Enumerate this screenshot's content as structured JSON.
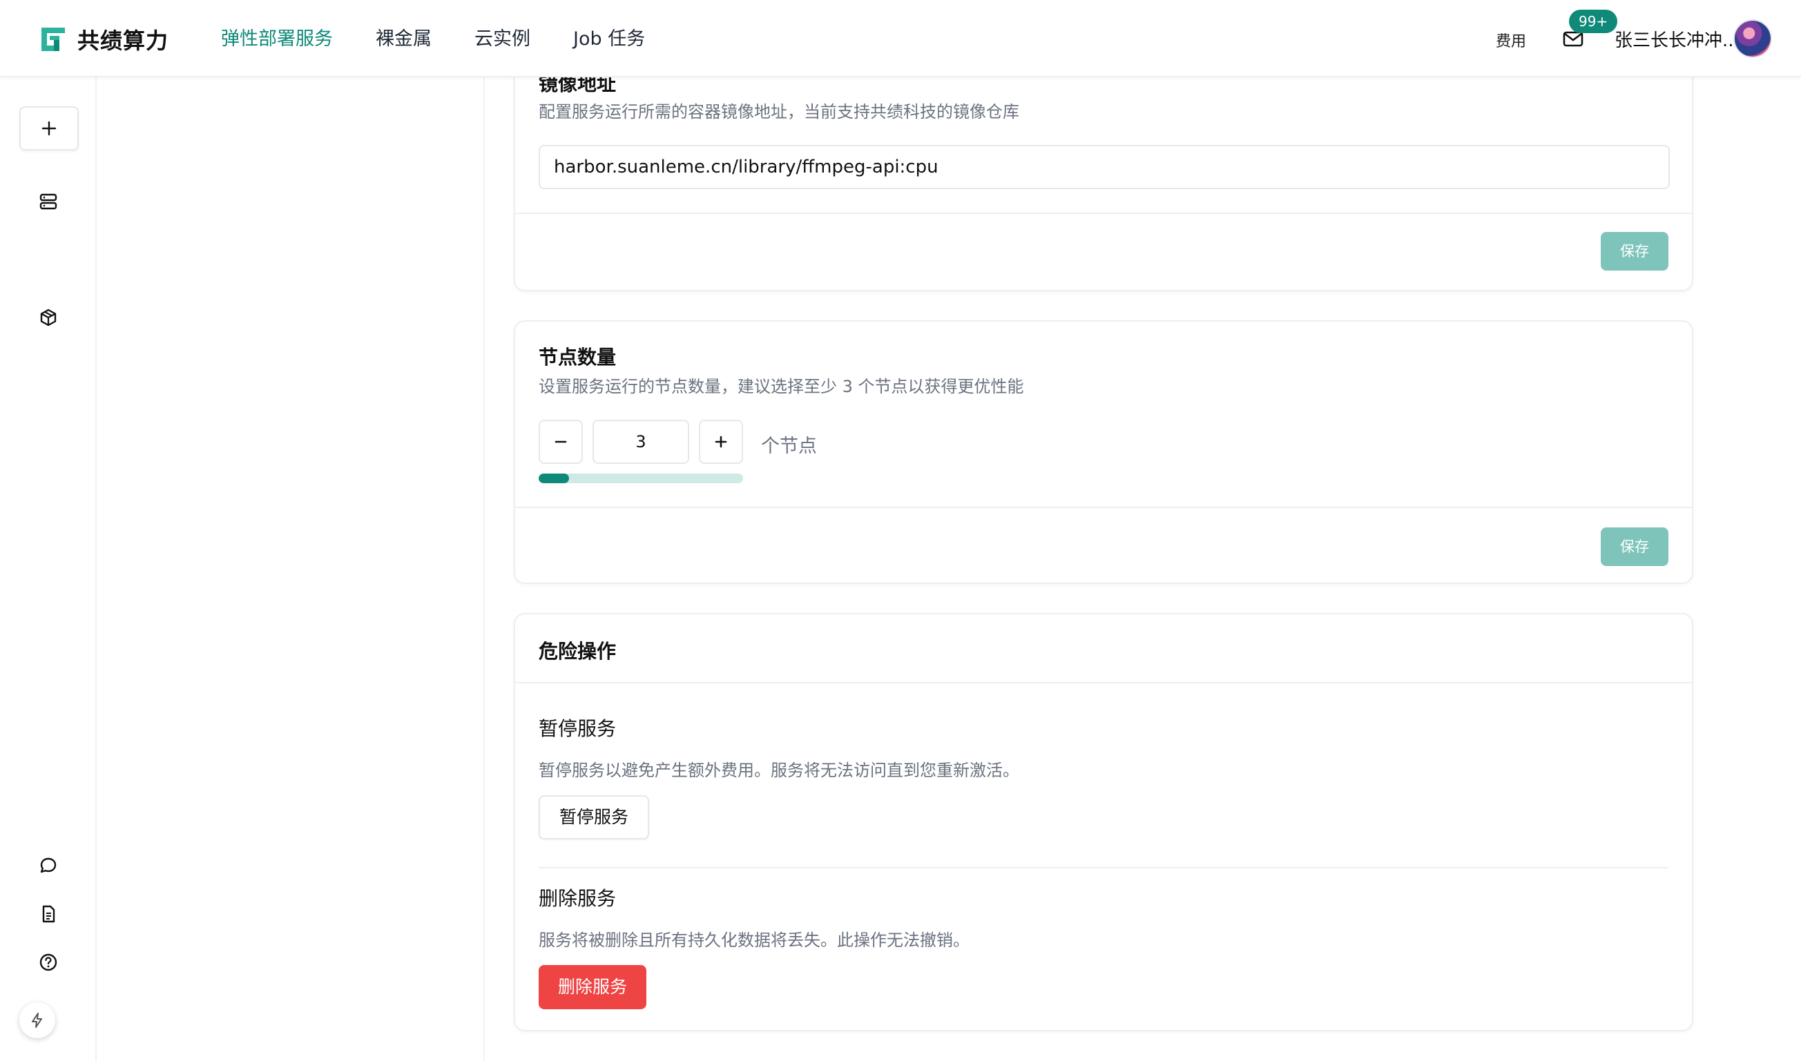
{
  "header": {
    "brand": "共绩算力",
    "nav": [
      "弹性部署服务",
      "裸金属",
      "云实例",
      "Job 任务"
    ],
    "active_nav": "弹性部署服务",
    "fee_label": "费用",
    "mail_badge": "99+",
    "username": "张三长长冲冲.."
  },
  "image_card": {
    "title": "镜像地址",
    "desc": "配置服务运行所需的容器镜像地址，当前支持共绩科技的镜像仓库",
    "value": "harbor.suanleme.cn/library/ffmpeg-api:cpu",
    "save_label": "保存"
  },
  "nodes_card": {
    "title": "节点数量",
    "desc": "设置服务运行的节点数量，建议选择至少 3 个节点以获得更优性能",
    "value": "3",
    "unit": "个节点",
    "progress_fraction": 0.15,
    "save_label": "保存"
  },
  "danger_card": {
    "title": "危险操作",
    "pause_title": "暂停服务",
    "pause_desc": "暂停服务以避免产生额外费用。服务将无法访问直到您重新激活。",
    "pause_button": "暂停服务",
    "delete_title": "删除服务",
    "delete_desc": "服务将被删除且所有持久化数据将丢失。此操作无法撤销。",
    "delete_button": "删除服务"
  },
  "colors": {
    "accent": "#0f8a79",
    "save_disabled": "#7fc4bb",
    "danger": "#ef4444",
    "muted_text": "#6b7280"
  }
}
